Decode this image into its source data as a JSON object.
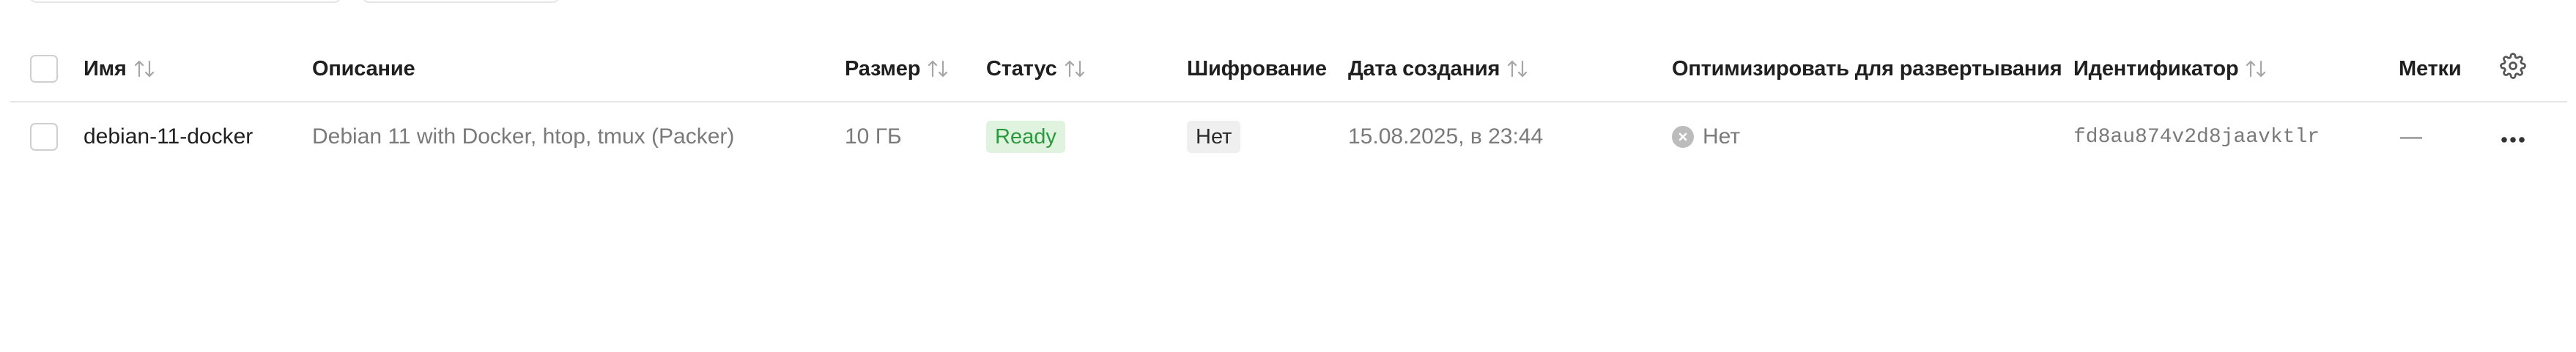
{
  "columns": {
    "name": "Имя",
    "description": "Описание",
    "size": "Размер",
    "status": "Статус",
    "encryption": "Шифрование",
    "created": "Дата создания",
    "optimize": "Оптимизировать для развертывания",
    "id": "Идентификатор",
    "labels": "Метки"
  },
  "rows": [
    {
      "name": "debian-11-docker",
      "description": "Debian 11 with Docker, htop, tmux (Packer)",
      "size": "10 ГБ",
      "status": "Ready",
      "encryption": "Нет",
      "created": "15.08.2025, в 23:44",
      "optimize": "Нет",
      "id": "fd8au874v2d8jaavktlr",
      "labels": "—"
    }
  ],
  "icons": {
    "sort": "sort-arrows-icon",
    "settings": "gear-icon",
    "actions": "more-horizontal-icon",
    "not_optimized": "x-circle-icon"
  },
  "colors": {
    "ready_bg": "#dff3df",
    "ready_text": "#2a9a3e",
    "no_bg": "#efefef",
    "divider": "#e6e6e6"
  }
}
